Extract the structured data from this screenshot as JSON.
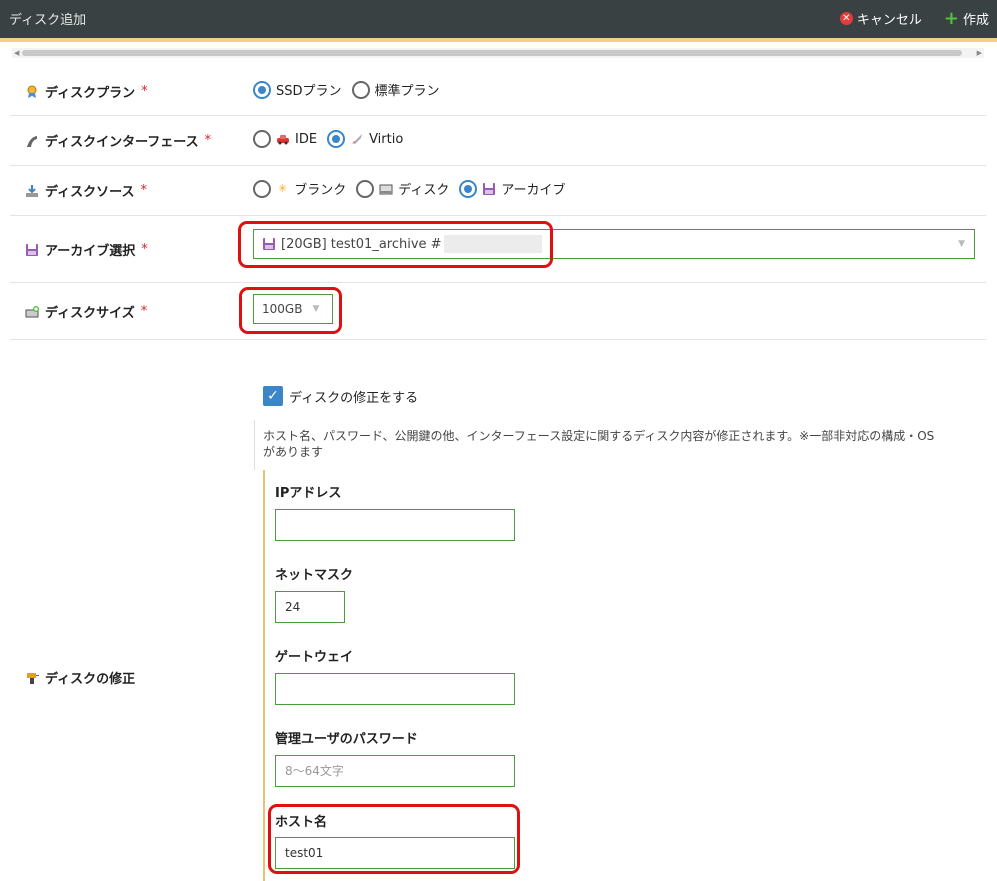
{
  "header": {
    "title": "ディスク追加",
    "cancel_label": "キャンセル",
    "create_label": "作成"
  },
  "plan": {
    "label": "ディスクプラン",
    "required": "*",
    "options": [
      "SSDプラン",
      "標準プラン"
    ],
    "selected": 0
  },
  "interface": {
    "label": "ディスクインターフェース",
    "required": "*",
    "options": [
      "IDE",
      "Virtio"
    ],
    "selected": 1
  },
  "source": {
    "label": "ディスクソース",
    "required": "*",
    "options": [
      "ブランク",
      "ディスク",
      "アーカイブ"
    ],
    "selected": 2
  },
  "archive": {
    "label": "アーカイブ選択",
    "required": "*",
    "value": "[20GB] test01_archive #"
  },
  "size": {
    "label": "ディスクサイズ",
    "required": "*",
    "value": "100GB"
  },
  "modify": {
    "label": "ディスクの修正",
    "checkbox_label": "ディスクの修正をする",
    "checked": true,
    "description_line1": "ホスト名、パスワード、公開鍵の他、インターフェース設定に関するディスク内容が修正されます。※一部非対応の構成・OS",
    "description_line2": "があります",
    "ip_label": "IPアドレス",
    "ip_value": "",
    "netmask_label": "ネットマスク",
    "netmask_value": "24",
    "gateway_label": "ゲートウェイ",
    "gateway_value": "",
    "password_label": "管理ユーザのパスワード",
    "password_placeholder": "8〜64文字",
    "hostname_label": "ホスト名",
    "hostname_value": "test01"
  },
  "colors": {
    "header_bg": "#394143",
    "accent": "#f3cf8c",
    "radio_on": "#3a86c8",
    "input_border": "#4b9a3c",
    "highlight": "#e01010"
  }
}
